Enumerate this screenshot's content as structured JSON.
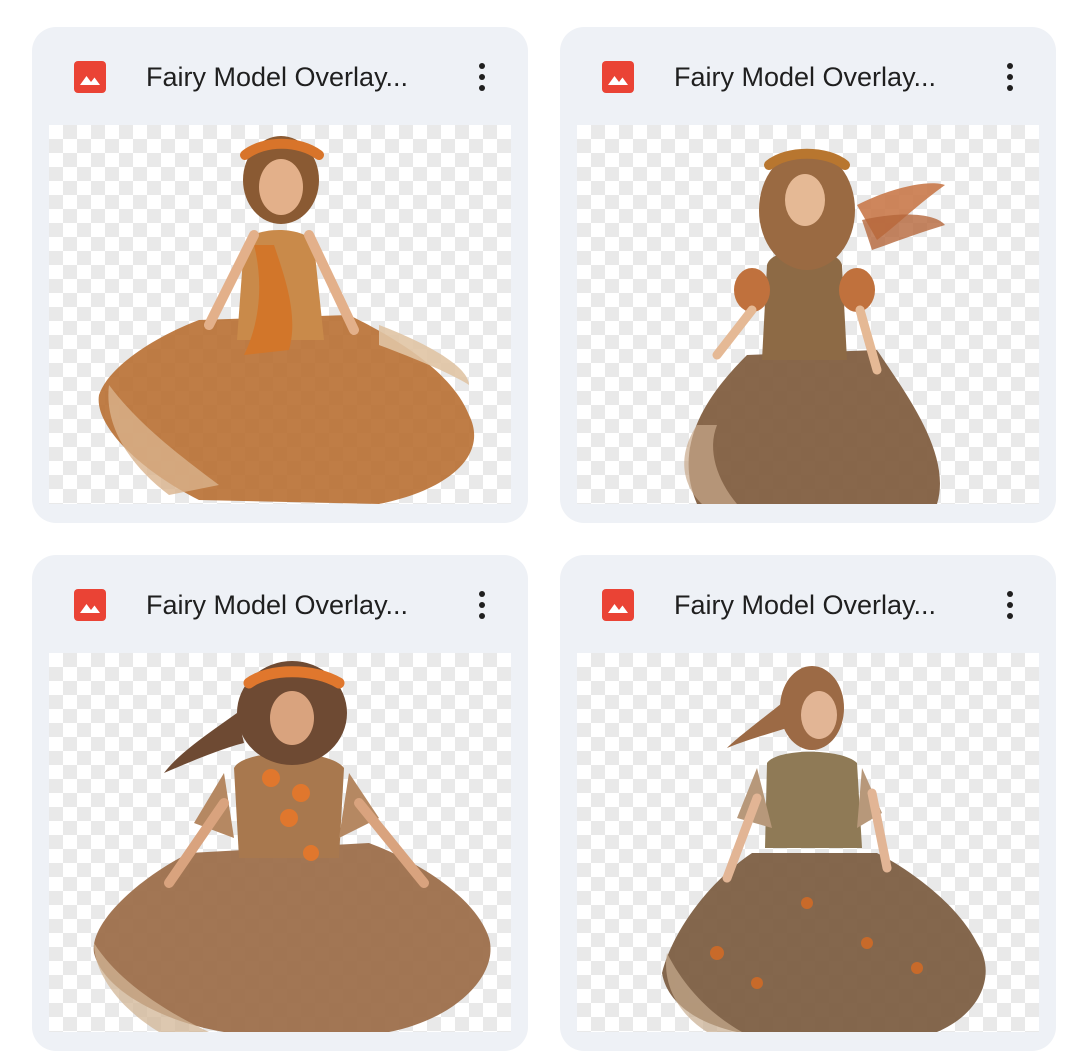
{
  "files": [
    {
      "title": "Fairy Model Overlay...",
      "type_icon": "image-file-icon",
      "menu_icon": "more-vert-icon"
    },
    {
      "title": "Fairy Model Overlay...",
      "type_icon": "image-file-icon",
      "menu_icon": "more-vert-icon"
    },
    {
      "title": "Fairy Model Overlay...",
      "type_icon": "image-file-icon",
      "menu_icon": "more-vert-icon"
    },
    {
      "title": "Fairy Model Overlay...",
      "type_icon": "image-file-icon",
      "menu_icon": "more-vert-icon"
    }
  ],
  "colors": {
    "card_background": "#eef1f6",
    "icon_red": "#ea4335",
    "title_text": "#1f1f1f"
  }
}
